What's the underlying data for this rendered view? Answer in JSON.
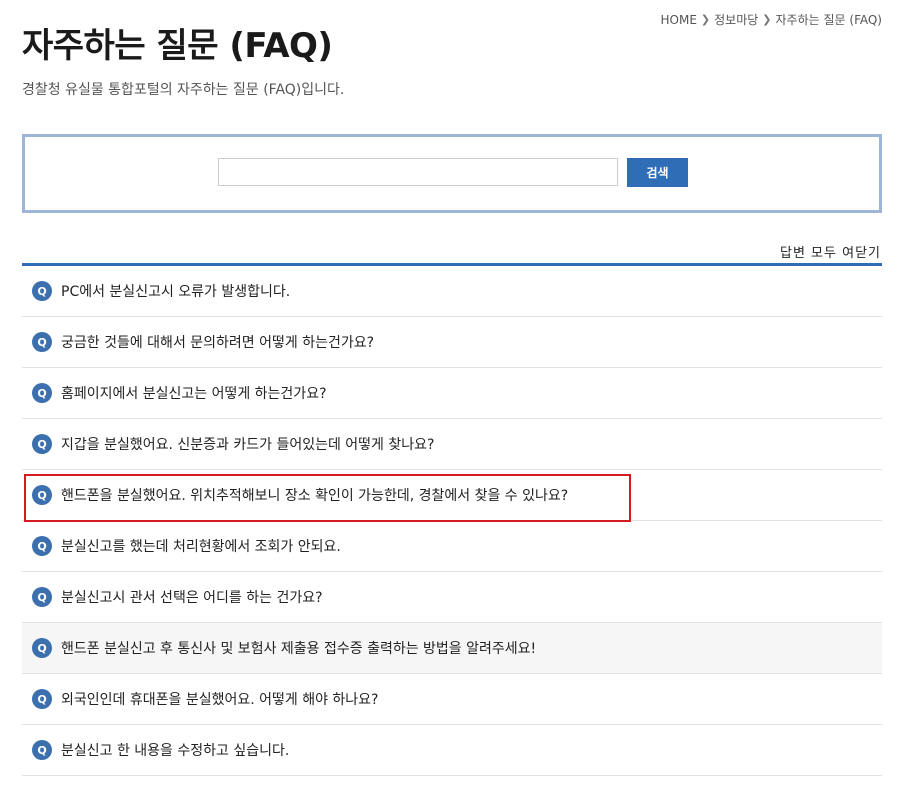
{
  "breadcrumb": {
    "items": [
      "HOME",
      "정보마당",
      "자주하는 질문 (FAQ)"
    ]
  },
  "header": {
    "title": "자주하는 질문 (FAQ)",
    "description": "경찰청 유실물 통합포털의 자주하는 질문 (FAQ)입니다."
  },
  "search": {
    "value": "",
    "placeholder": "",
    "button_label": "검색"
  },
  "toggle_all_label": "답변 모두 여닫기",
  "faq": {
    "badge": "Q",
    "items": [
      {
        "question": "PC에서 분실신고시 오류가 발생합니다."
      },
      {
        "question": "궁금한 것들에 대해서 문의하려면 어떻게 하는건가요?"
      },
      {
        "question": "홈페이지에서 분실신고는 어떻게 하는건가요?"
      },
      {
        "question": "지갑을 분실했어요. 신분증과 카드가 들어있는데 어떻게 찾나요?"
      },
      {
        "question": "핸드폰을 분실했어요. 위치추적해보니 장소 확인이 가능한데, 경찰에서 찾을 수 있나요?"
      },
      {
        "question": "분실신고를 했는데 처리현황에서 조회가 안되요."
      },
      {
        "question": "분실신고시 관서 선택은 어디를 하는 건가요?"
      },
      {
        "question": "핸드폰 분실신고 후 통신사 및 보험사 제출용 접수증 출력하는 방법을 알려주세요!"
      },
      {
        "question": "외국인인데 휴대폰을 분실했어요. 어떻게 해야 하나요?"
      },
      {
        "question": "분실신고 한 내용을 수정하고 싶습니다."
      }
    ]
  },
  "colors": {
    "accent": "#2f6db6",
    "badge": "#3b6fae",
    "search_border": "#9db6d8",
    "highlight": "#d71920",
    "hover_row": "#f6f6f6"
  }
}
